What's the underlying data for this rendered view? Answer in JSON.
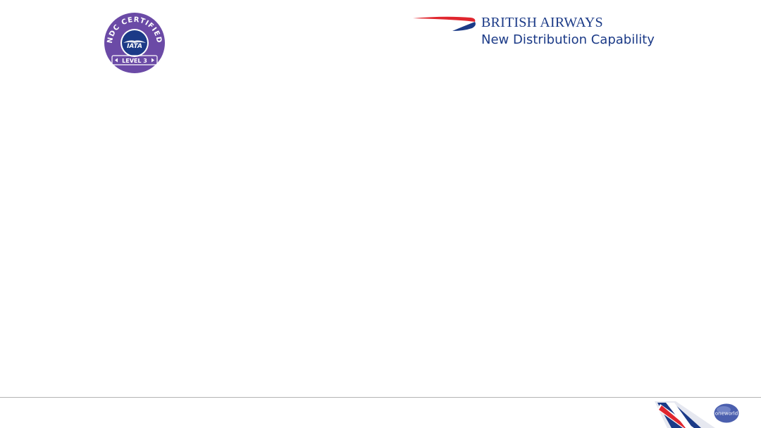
{
  "badge": {
    "arc_text": "NDC CERTIFIED",
    "org": "IATA",
    "level": "LEVEL 3",
    "color": "#6b4aa6"
  },
  "brand": {
    "name": "BRITISH AIRWAYS",
    "subtitle": "New Distribution Capability",
    "text_color": "#1b3a87",
    "speedmarque_red": "#e0262e",
    "speedmarque_blue": "#1b3a87"
  },
  "footer": {
    "alliance_logo_text": "oneworld",
    "alliance_color": "#4b5fae"
  }
}
